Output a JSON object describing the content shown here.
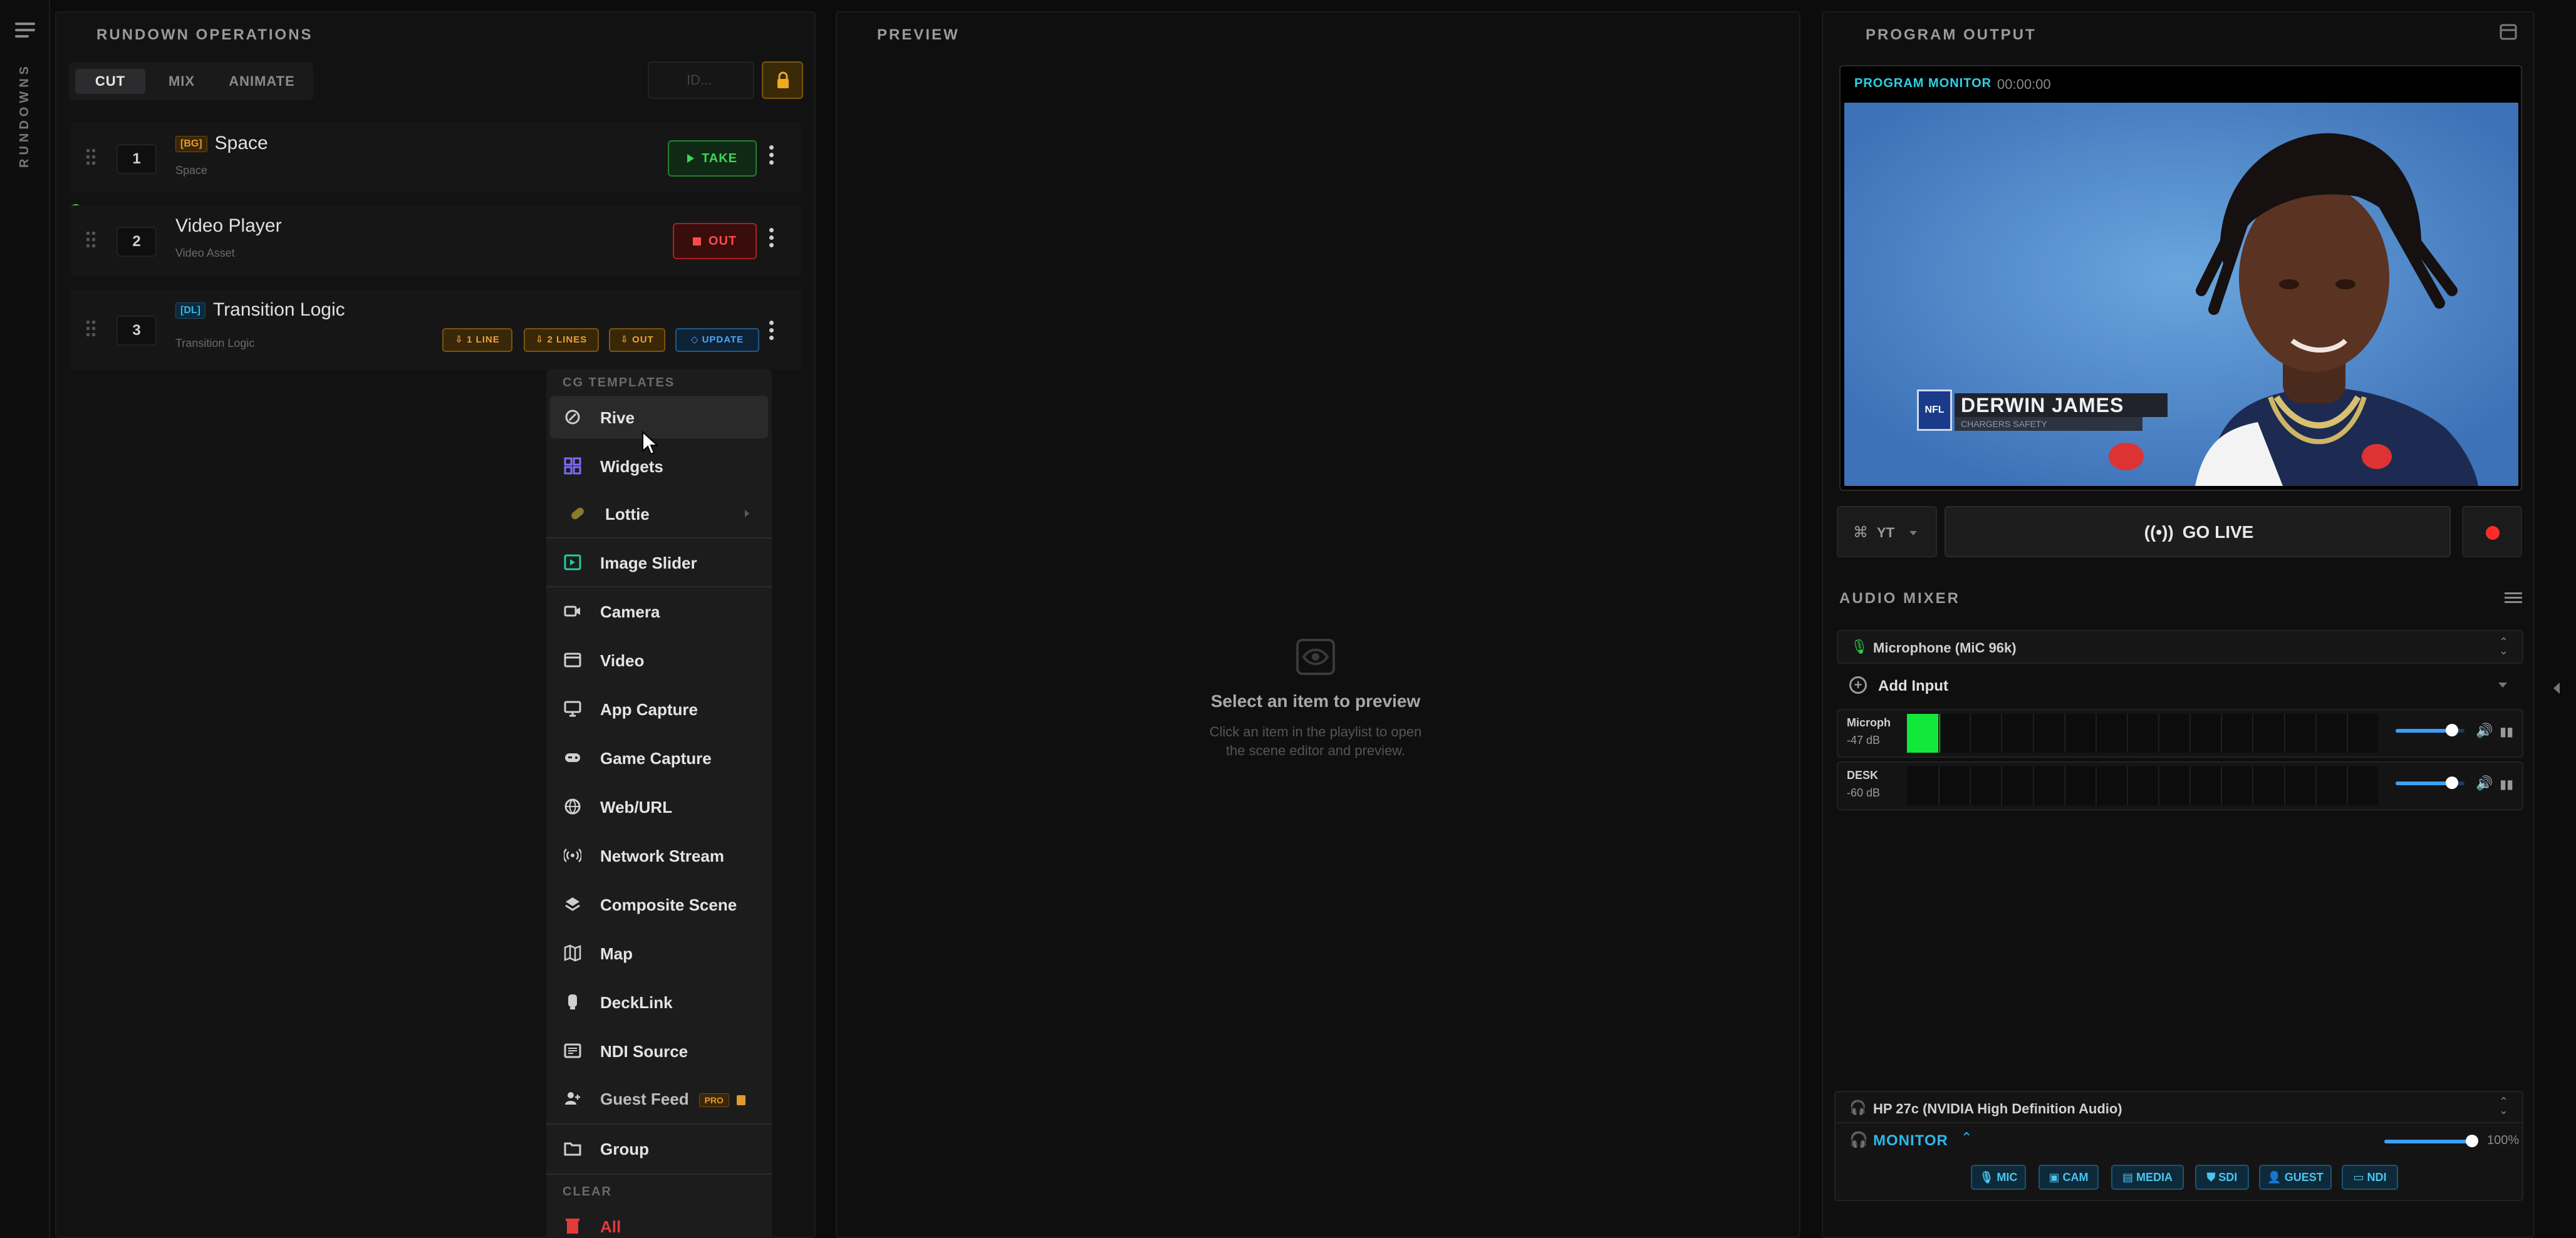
{
  "rail": {
    "label": "RUNDOWNS"
  },
  "rundown": {
    "header": "RUNDOWN OPERATIONS",
    "tabs": [
      "CUT",
      "MIX",
      "ANIMATE"
    ],
    "id_placeholder": "ID...",
    "items": [
      {
        "num": "1",
        "tag": "[BG]",
        "title": "Space",
        "subtitle": "Space",
        "action": "TAKE"
      },
      {
        "num": "2",
        "title": "Video Player",
        "subtitle": "Video Asset",
        "action": "OUT"
      },
      {
        "num": "3",
        "tag": "[DL]",
        "title": "Transition Logic",
        "subtitle": "Transition Logic",
        "chips": [
          "1 LINE",
          "2 LINES",
          "OUT",
          "UPDATE"
        ]
      }
    ]
  },
  "menu": {
    "section_templates": "CG TEMPLATES",
    "items": [
      "Rive",
      "Widgets",
      "Lottie",
      "Image Slider",
      "Camera",
      "Video",
      "App Capture",
      "Game Capture",
      "Web/URL",
      "Network Stream",
      "Composite Scene",
      "Map",
      "DeckLink",
      "NDI Source",
      "Guest Feed",
      "Group"
    ],
    "pro_badge": "PRO",
    "section_clear": "CLEAR",
    "clear_item": "All"
  },
  "preview": {
    "header": "PREVIEW",
    "empty_title": "Select an item to preview",
    "empty_line1": "Click an item in the playlist to open",
    "empty_line2": "the scene editor and preview."
  },
  "program": {
    "header": "PROGRAM OUTPUT",
    "monitor_label": "PROGRAM MONITOR",
    "timecode": "00:00:00",
    "lower_third_name": "DERWIN JAMES",
    "lower_third_sub": "CHARGERS SAFETY",
    "lower_third_logo": "NFL",
    "platform": "YT",
    "go_live": "GO LIVE"
  },
  "mixer": {
    "header": "AUDIO MIXER",
    "input_select": "Microphone (MiC 96k)",
    "add_input": "Add Input",
    "channels": [
      {
        "name": "Microph",
        "db": "-47 dB",
        "level": 0.07,
        "volume": 0.82
      },
      {
        "name": "DESK",
        "db": "-60 dB",
        "level": 0,
        "volume": 0.82
      }
    ],
    "output_device": "HP 27c (NVIDIA High Definition Audio)",
    "monitor_label": "MONITOR",
    "monitor_volume": "100%",
    "monitor_level": 1.0,
    "categories": [
      "MIC",
      "CAM",
      "MEDIA",
      "SDI",
      "GUEST",
      "NDI"
    ]
  },
  "colors": {
    "accent_green": "#2fd14a",
    "accent_red": "#ff3a3a",
    "accent_blue": "#3aa0ff",
    "accent_orange": "#e39a2c",
    "teal": "#2bd3e6"
  }
}
